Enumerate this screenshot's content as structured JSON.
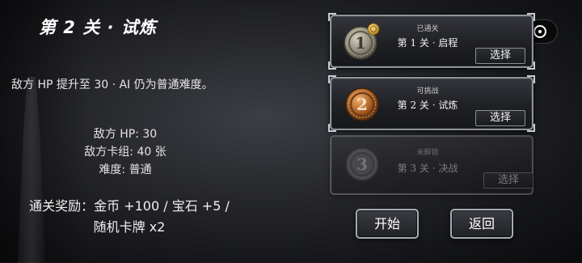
{
  "level": {
    "title": "第 2 关 · 试炼",
    "description": "敌方 HP 提升至 30 · AI 仍为普通难度。",
    "stats": {
      "enemy_hp": "敌方 HP: 30",
      "enemy_deck": "敌方卡组: 40 张",
      "difficulty": "难度: 普通"
    },
    "rewards": {
      "line1": "通关奖励：金币 +100 / 宝石 +5 /",
      "line2": "随机卡牌 x2"
    }
  },
  "stages": [
    {
      "number": "1",
      "status": "已通关",
      "name": "第 1 关 · 启程",
      "select_label": "选择",
      "medal": "silver-medal",
      "badge": "gold-coin-badge"
    },
    {
      "number": "2",
      "status": "可挑战",
      "name": "第 2 关 · 试炼",
      "select_label": "选择",
      "medal": "bronze-medal"
    },
    {
      "number": "3",
      "status": "未解锁",
      "name": "第 3 关 · 决战",
      "select_label": "选择",
      "medal": "locked-medal"
    }
  ],
  "actions": {
    "start_label": "开始",
    "back_label": "返回"
  },
  "colors": {
    "background": "#1e1f23",
    "card_border": "#8f949c",
    "text": "#e8e8e8"
  }
}
